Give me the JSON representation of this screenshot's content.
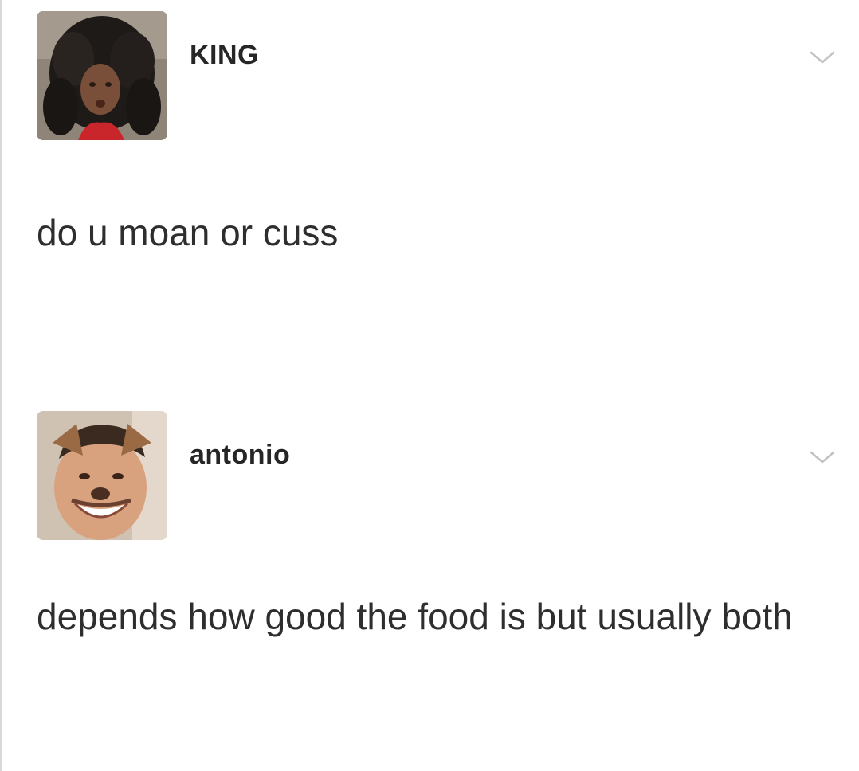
{
  "posts": [
    {
      "username": "KING",
      "avatar_icon": "profile-photo",
      "menu_icon": "chevron-down-icon",
      "message": "do u moan or cuss"
    },
    {
      "username": "antonio",
      "avatar_icon": "profile-photo",
      "menu_icon": "chevron-down-icon",
      "message": "depends how good the food is but usually both"
    }
  ],
  "colors": {
    "background": "#ffffff",
    "text": "#2e2e2e",
    "chevron": "#c2c2c2"
  }
}
